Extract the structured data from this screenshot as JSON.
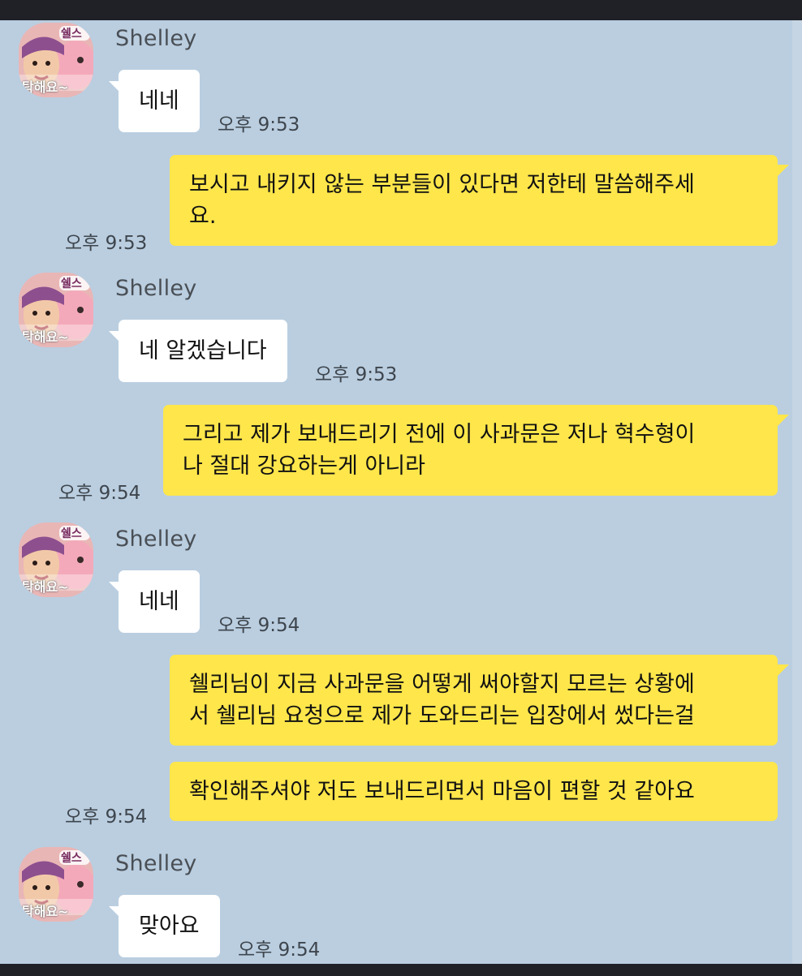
{
  "messages": [
    {
      "sender": "Shelley",
      "direction": "in",
      "text": "네네",
      "time": "오후 9:53",
      "avatar_caption": "탁해요~",
      "avatar_badge": "쉘스"
    },
    {
      "direction": "out",
      "lines": [
        "보시고 내키지 않는 부분들이 있다면 저한테 말씀해주세",
        "요."
      ],
      "time": "오후 9:53"
    },
    {
      "sender": "Shelley",
      "direction": "in",
      "text": "네 알겠습니다",
      "time": "오후 9:53",
      "avatar_caption": "탁해요~",
      "avatar_badge": "쉘스"
    },
    {
      "direction": "out",
      "lines": [
        "그리고 제가 보내드리기 전에 이 사과문은 저나 혁수형이",
        "나 절대 강요하는게 아니라"
      ],
      "time": "오후 9:54"
    },
    {
      "sender": "Shelley",
      "direction": "in",
      "text": "네네",
      "time": "오후 9:54",
      "avatar_caption": "탁해요~",
      "avatar_badge": "쉘스"
    },
    {
      "direction": "out",
      "lines": [
        "쉘리님이 지금 사과문을 어떻게 써야할지 모르는 상황에",
        "서 쉘리님 요청으로 제가 도와드리는 입장에서 썼다는걸"
      ]
    },
    {
      "direction": "out",
      "lines": [
        "확인해주셔야 저도 보내드리면서 마음이 편할 것 같아요"
      ],
      "time": "오후 9:54"
    },
    {
      "sender": "Shelley",
      "direction": "in",
      "text": "맞아요",
      "time": "오후 9:54",
      "avatar_caption": "탁해요~",
      "avatar_badge": "쉘스"
    }
  ],
  "colors": {
    "background": "#bacee0",
    "outgoing_bubble": "#fee64b",
    "incoming_bubble": "#ffffff",
    "frame": "#1f2127"
  }
}
